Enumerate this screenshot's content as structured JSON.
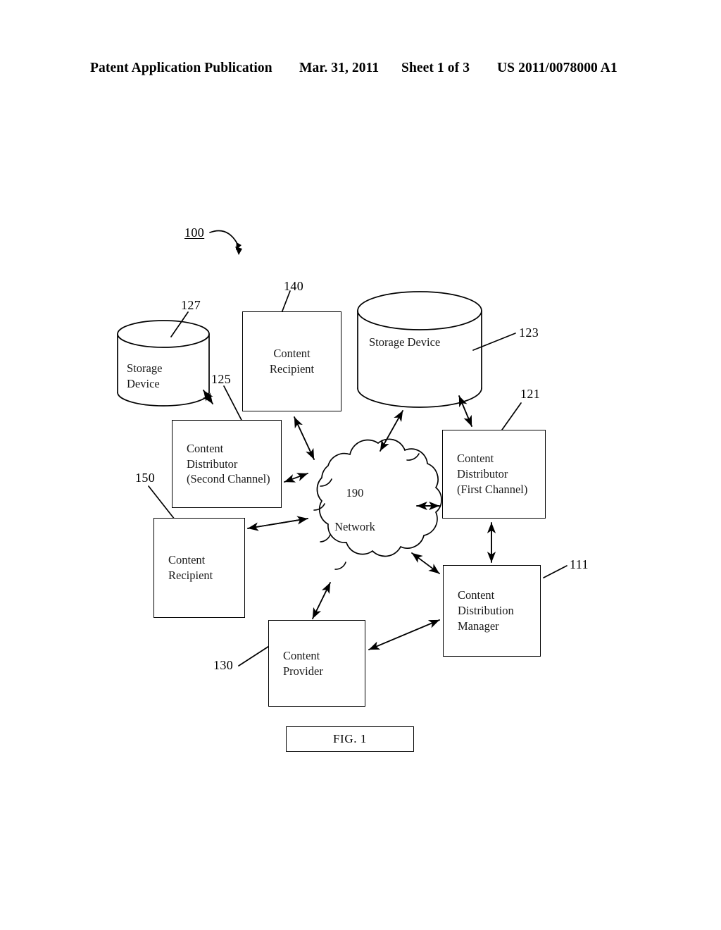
{
  "header": {
    "publication": "Patent Application Publication",
    "date": "Mar. 31, 2011",
    "sheet": "Sheet 1 of 3",
    "doc_number": "US 2011/0078000 A1"
  },
  "figure": {
    "caption": "FIG. 1",
    "system_ref": "100",
    "nodes": {
      "storage_device_left": {
        "ref": "127",
        "line1": "Storage",
        "line2": "Device"
      },
      "content_recipient_top": {
        "ref": "140",
        "line1": "Content",
        "line2": "Recipient"
      },
      "storage_device_right": {
        "ref": "123",
        "line1": "Storage Device"
      },
      "content_distributor_second": {
        "ref": "125",
        "line1": "Content",
        "line2": "Distributor",
        "line3": "(Second Channel)"
      },
      "content_distributor_first": {
        "ref": "121",
        "line1": "Content",
        "line2": "Distributor",
        "line3": "(First Channel)"
      },
      "content_recipient_left": {
        "ref": "150",
        "line1": "Content",
        "line2": "Recipient"
      },
      "content_provider": {
        "ref": "130",
        "line1": "Content",
        "line2": "Provider"
      },
      "content_distribution_manager": {
        "ref": "111",
        "line1": "Content",
        "line2": "Distribution",
        "line3": "Manager"
      },
      "network_cloud": {
        "ref": "190",
        "label": "Network"
      }
    }
  }
}
